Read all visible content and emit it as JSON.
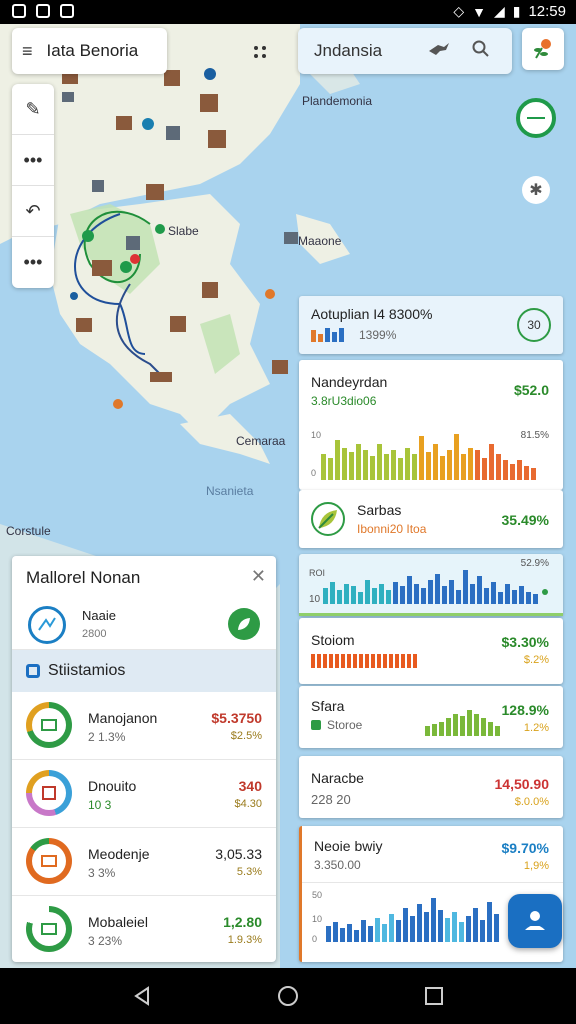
{
  "status": {
    "time": "12:59"
  },
  "search_left": {
    "title": "Iata Benoria"
  },
  "search_right": {
    "title": "Jndansia"
  },
  "map": {
    "labels": [
      "Plandemonia",
      "Slabe",
      "Maaone",
      "Cemaraa",
      "Nsanieta",
      "Corstule"
    ]
  },
  "right_panels": {
    "p1": {
      "label": "Aotuplian I4 8300%",
      "sub": "1399%",
      "badge": "30"
    },
    "p2": {
      "label": "Nandeyrdan",
      "sub": "3.8rU3dio06",
      "value": "$52.0",
      "axis_top": "10",
      "axis_bottom": "0",
      "pct": "81.5%"
    },
    "p3": {
      "label": "Sarbas",
      "sub": "Ibonni20  Itoa",
      "value": "35.49%"
    },
    "p4": {
      "axis_top": "ROI",
      "axis_mid": "10",
      "pct": "52.9%"
    },
    "p5": {
      "label": "Stoiom",
      "value": "$3.30%",
      "value2": "$.2%"
    },
    "p6": {
      "label": "Sfara",
      "sub": "Storoe",
      "value": "128.9%",
      "value2": "1.2%"
    },
    "p7": {
      "label": "Naracbe",
      "sub": "228    20",
      "value": "14,50.90",
      "value2": "$.0.0%"
    },
    "p8": {
      "label": "Neoie bwiy",
      "sub": "3.350.00",
      "value": "$9.70%",
      "value2": "1,9%",
      "axis": [
        "50",
        "10",
        "0"
      ]
    }
  },
  "left_panel": {
    "title": "Mallorel Nonan",
    "first": {
      "name": "Naaie",
      "sub": "2800"
    },
    "section_title": "Stiistamios",
    "rows": [
      {
        "name": "Manojanon",
        "sub": "2 1.3%",
        "amount": "$5.3750",
        "pct": "$2.5%",
        "amount_color": "#c0392b",
        "ring": "#2e9b45"
      },
      {
        "name": "Dnouito",
        "sub": "10 3",
        "amount": "340",
        "pct": "$4.30",
        "amount_color": "#c0392b",
        "ring": "#3aa0d8"
      },
      {
        "name": "Meodenje",
        "sub": "3 3%",
        "amount": "3,05.33",
        "pct": "5.3%",
        "amount_color": "#222",
        "ring": "#e06a20"
      },
      {
        "name": "Mobaleiel",
        "sub": "3 23%",
        "amount": "1,2.80",
        "pct": "1.9.3%",
        "amount_color": "#2a8a2a",
        "ring": "#2e9b45"
      }
    ]
  }
}
